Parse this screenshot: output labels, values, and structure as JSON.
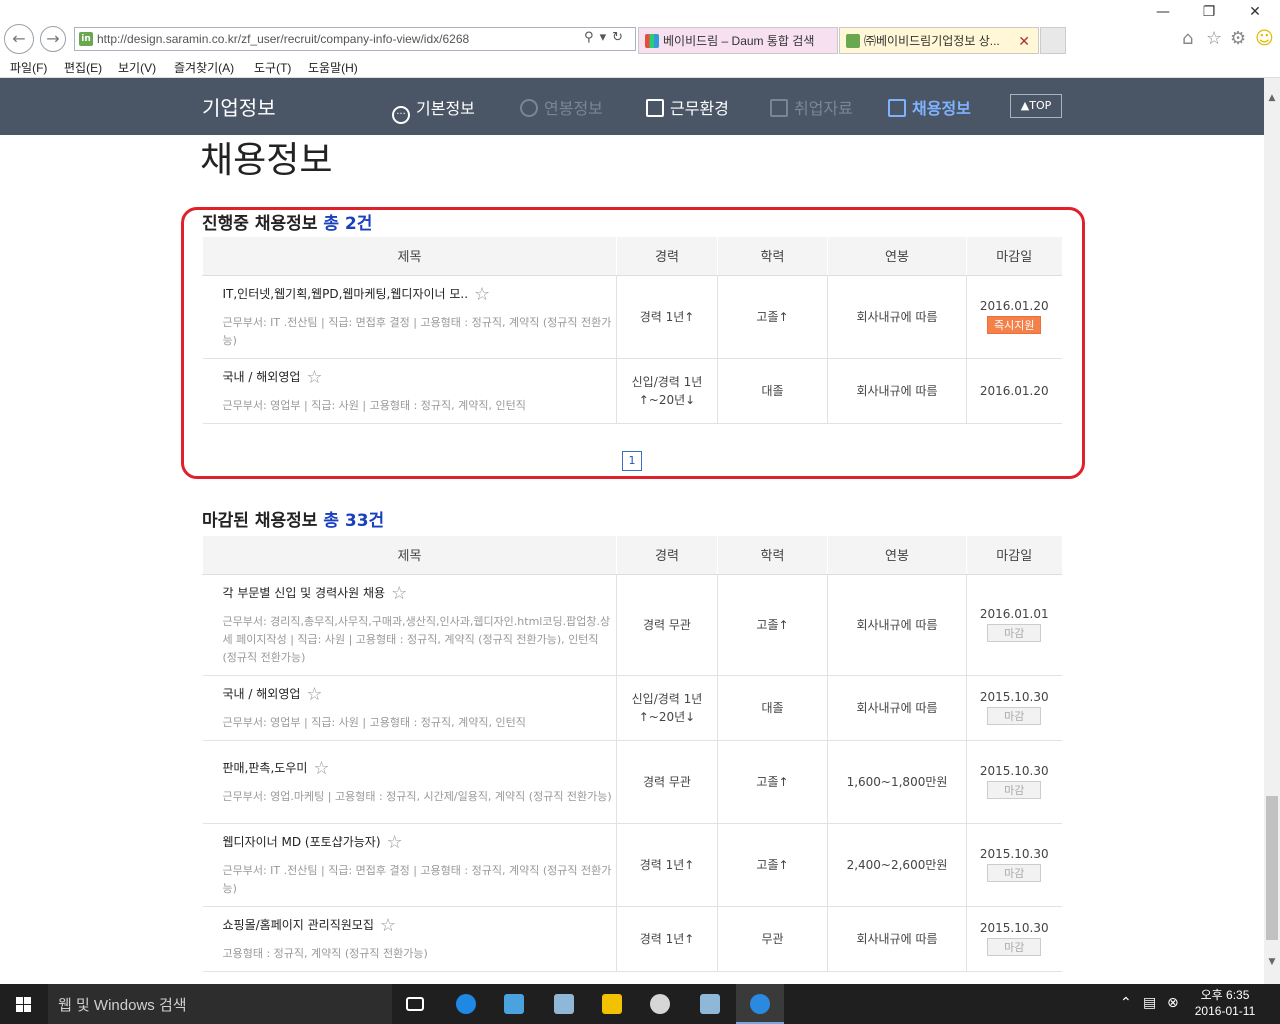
{
  "browser": {
    "url": "http://design.saramin.co.kr/zf_user/recruit/company-info-view/idx/6268",
    "tabs": [
      {
        "label": "베이비드림 – Daum 통합 검색",
        "color": "#f7e0f0"
      },
      {
        "label": "㈜베이비드림기업정보 상...",
        "color": "#fff7d6"
      }
    ],
    "menu": [
      "파일(F)",
      "편집(E)",
      "보기(V)",
      "즐겨찾기(A)",
      "도구(T)",
      "도움말(H)"
    ]
  },
  "site_header": {
    "brand": "기업정보",
    "nav": [
      "기본정보",
      "연봉정보",
      "근무환경",
      "취업자료",
      "채용정보"
    ],
    "active_nav": "채용정보",
    "top_label": "TOP"
  },
  "page_title": "채용정보",
  "columns": [
    "제목",
    "경력",
    "학력",
    "연봉",
    "마감일"
  ],
  "ongoing": {
    "title": "진행중 채용정보",
    "count": "총 2건",
    "rows": [
      {
        "title": "IT,인터넷,웹기획,웹PD,웹마케팅,웹디자이너 모..",
        "meta": "근무부서: IT .전산팀 | 직급: 면접후 결정 | 고용형태 : 정규직, 계약직 (정규직 전환가능)",
        "career": "경력 1년↑",
        "edu": "고졸↑",
        "salary": "회사내규에 따름",
        "date": "2016.01.20",
        "badge": "즉시지원"
      },
      {
        "title": "국내 / 해외영업",
        "meta": "근무부서: 영업부 | 직급: 사원 | 고용형태 : 정규직, 계약직, 인턴직",
        "career": "신입/경력 1년↑~20년↓",
        "edu": "대졸",
        "salary": "회사내규에 따름",
        "date": "2016.01.20",
        "badge": ""
      }
    ],
    "page": "1"
  },
  "closed": {
    "title": "마감된 채용정보",
    "count": "총 33건",
    "rows": [
      {
        "title": "각 부문별 신입 및 경력사원 채용",
        "meta": "근무부서: 경리직,총무직,사무직,구매과,생산직,인사과,웹디자인.html코딩.팝업창.상세 페이지작성 | 직급: 사원 | 고용형태 : 정규직, 계약직 (정규직 전환가능), 인턴직 (정규직 전환가능)",
        "career": "경력 무관",
        "edu": "고졸↑",
        "salary": "회사내규에 따름",
        "date": "2016.01.01",
        "badge": "마감"
      },
      {
        "title": "국내 / 해외영업",
        "meta": "근무부서: 영업부 | 직급: 사원 | 고용형태 : 정규직, 계약직, 인턴직",
        "career": "신입/경력 1년↑~20년↓",
        "edu": "대졸",
        "salary": "회사내규에 따름",
        "date": "2015.10.30",
        "badge": "마감"
      },
      {
        "title": "판매,판촉,도우미",
        "meta": "근무부서: 영업.마케팅 | 고용형태 : 정규직, 시간제/일용직, 계약직 (정규직 전환가능)",
        "career": "경력 무관",
        "edu": "고졸↑",
        "salary": "1,600~1,800만원",
        "date": "2015.10.30",
        "badge": "마감"
      },
      {
        "title": "웹디자이너 MD (포토샵가능자)",
        "meta": "근무부서: IT .전산팀 | 직급: 면접후 결정 | 고용형태 : 정규직, 계약직 (정규직 전환가능)",
        "career": "경력 1년↑",
        "edu": "고졸↑",
        "salary": "2,400~2,600만원",
        "date": "2015.10.30",
        "badge": "마감"
      },
      {
        "title": "쇼핑몰/홈페이지 관리직원모집",
        "meta": "고용형태 : 정규직, 계약직 (정규직 전환가능)",
        "career": "경력 1년↑",
        "edu": "무관",
        "salary": "회사내규에 따름",
        "date": "2015.10.30",
        "badge": "마감"
      }
    ]
  },
  "taskbar": {
    "search_placeholder": "웹 및 Windows 검색",
    "time": "오후 6:35",
    "date": "2016-01-11"
  },
  "colors": {
    "header_bg": "#4a5565",
    "accent_blue": "#1a3fbf",
    "highlight_red": "#e0202a",
    "apply_orange": "#f5814a"
  }
}
